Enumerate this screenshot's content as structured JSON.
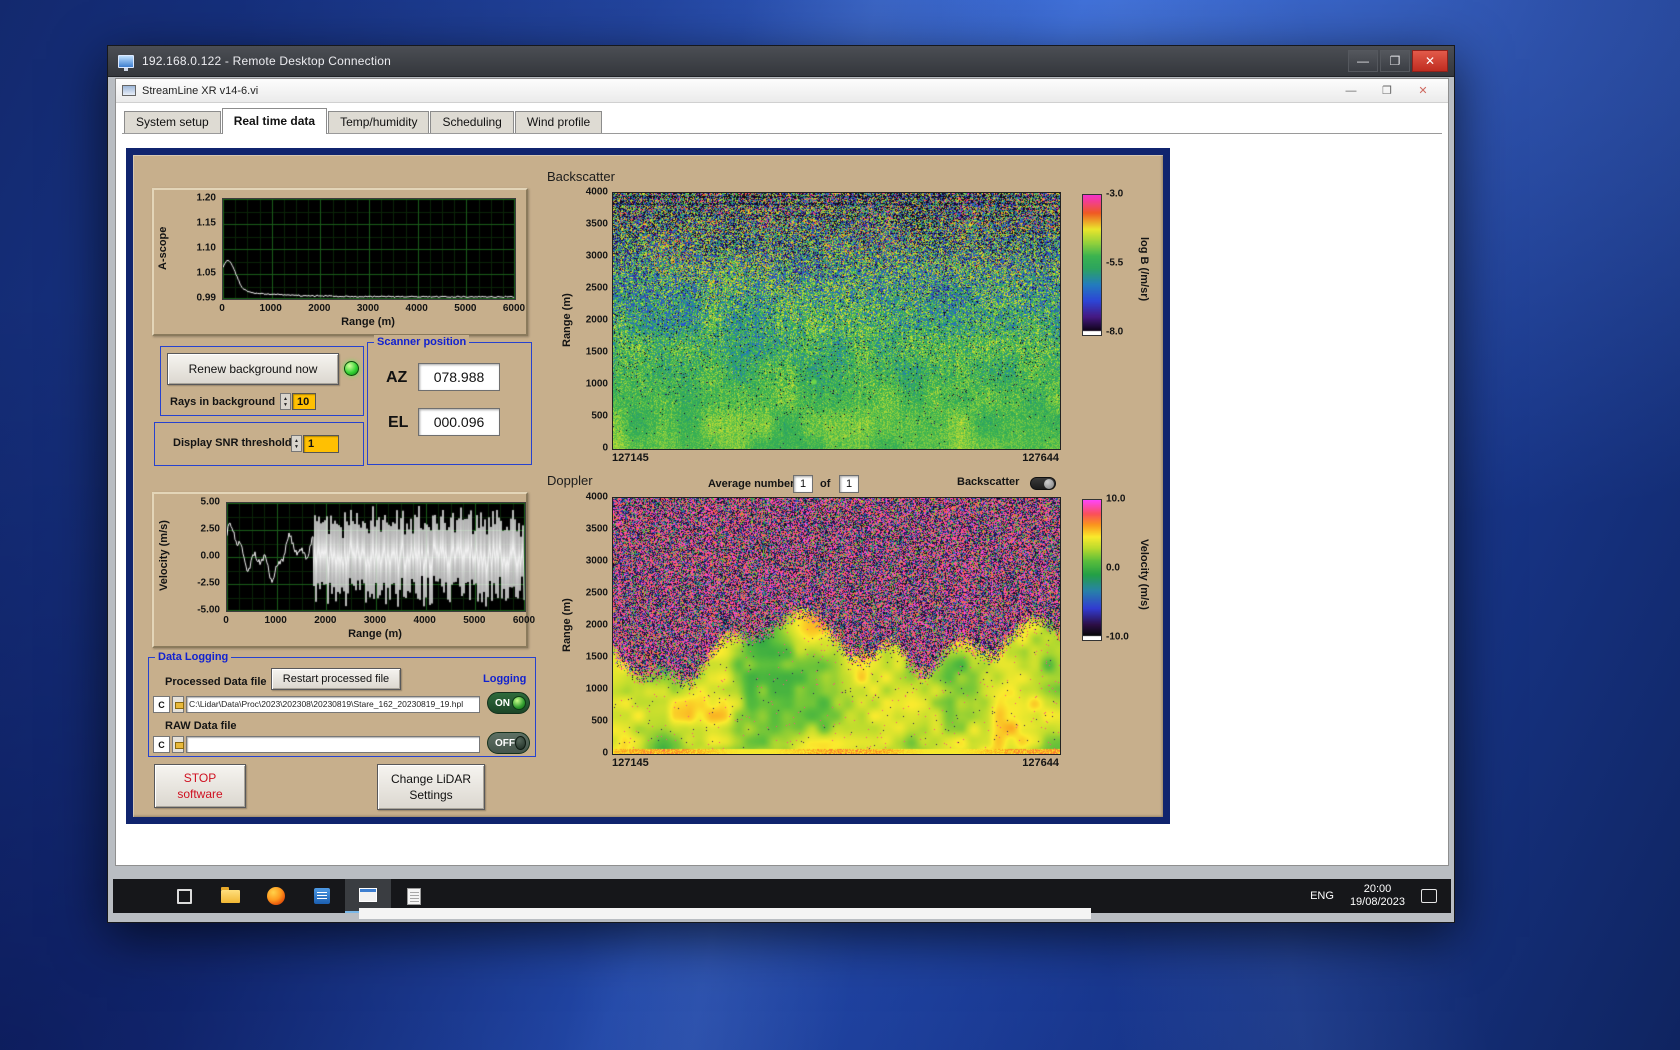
{
  "rdp": {
    "title": "192.168.0.122 - Remote Desktop Connection"
  },
  "glyphs": {
    "minimize": "—",
    "restore": "❐",
    "maximize": "▢",
    "close": "✕",
    "spin_up": "▲",
    "spin_down": "▼"
  },
  "app": {
    "title": "StreamLine XR v14-6.vi",
    "tabs": [
      {
        "label": "System setup"
      },
      {
        "label": "Real time data"
      },
      {
        "label": "Temp/humidity"
      },
      {
        "label": "Scheduling"
      },
      {
        "label": "Wind profile"
      }
    ]
  },
  "ascope": {
    "ylabel": "A-scope",
    "xlabel": "Range (m)",
    "yticks": [
      "1.20",
      "1.15",
      "1.10",
      "1.05",
      "0.99"
    ],
    "xticks": [
      "0",
      "1000",
      "2000",
      "3000",
      "4000",
      "5000",
      "6000"
    ]
  },
  "controls": {
    "renew_button": "Renew background now",
    "rays_label": "Rays in background",
    "rays_value": "10",
    "snr_label": "Display SNR threshold",
    "snr_value": "1"
  },
  "scanner": {
    "title": "Scanner position",
    "az_label": "AZ",
    "az_value": "078.988",
    "el_label": "EL",
    "el_value": "000.096"
  },
  "backscatter": {
    "title": "Backscatter",
    "ylabel": "Range (m)",
    "yticks": [
      "4000",
      "3500",
      "3000",
      "2500",
      "2000",
      "1500",
      "1000",
      "500",
      "0"
    ],
    "x_start": "127145",
    "x_end": "127644",
    "colorbar_ticks": [
      "-3.0",
      "-5.5",
      "-8.0"
    ],
    "colorbar_label": "log B (/m/sr)"
  },
  "doppler": {
    "title": "Doppler",
    "average_label": "Average number",
    "average_value": "1",
    "of_label": "of",
    "of_total": "1",
    "backscatter_toggle_label": "Backscatter",
    "ylabel": "Range (m)",
    "yticks": [
      "4000",
      "3500",
      "3000",
      "2500",
      "2000",
      "1500",
      "1000",
      "500",
      "0"
    ],
    "x_start": "127145",
    "x_end": "127644",
    "colorbar_ticks": [
      "10.0",
      "0.0",
      "-10.0"
    ],
    "colorbar_label": "Velocity (m/s)"
  },
  "velocity": {
    "ylabel": "Velocity (m/s)",
    "xlabel": "Range (m)",
    "yticks": [
      "5.00",
      "2.50",
      "0.00",
      "-2.50",
      "-5.00"
    ],
    "xticks": [
      "0",
      "1000",
      "2000",
      "3000",
      "4000",
      "5000",
      "6000"
    ]
  },
  "logging": {
    "title": "Data Logging",
    "processed_label": "Processed Data file",
    "restart_button": "Restart processed file",
    "logging_label": "Logging",
    "drive": "C",
    "processed_path": "C:\\Lidar\\Data\\Proc\\2023\\202308\\20230819\\Stare_162_20230819_19.hpl",
    "on_label": "ON",
    "raw_label": "RAW Data file",
    "raw_path": "",
    "off_label": "OFF"
  },
  "buttons": {
    "stop_line1": "STOP",
    "stop_line2": "software",
    "change_line1": "Change LiDAR",
    "change_line2": "Settings"
  },
  "taskbar": {
    "lang": "ENG",
    "time": "20:00",
    "date": "19/08/2023"
  },
  "colors": {
    "panel_tan": "#c7af8c",
    "panel_border": "#10246e",
    "group_blue": "#2742cf",
    "value_orange": "#ffc002",
    "led_green": "#35d435",
    "close_red": "#d23b2f"
  },
  "chart_data": [
    {
      "type": "line",
      "title": "A-scope",
      "xlabel": "Range (m)",
      "ylabel": "A-scope",
      "xlim": [
        0,
        6000
      ],
      "ylim": [
        0.99,
        1.2
      ],
      "x": [
        0,
        250,
        500,
        1000,
        1500,
        2000,
        2500,
        3000,
        3500,
        4000,
        4500,
        5000,
        5500,
        6000
      ],
      "values": [
        1.04,
        1.058,
        1.01,
        0.998,
        0.996,
        0.995,
        0.995,
        0.995,
        0.994,
        0.994,
        0.994,
        0.993,
        0.993,
        0.993
      ],
      "grid": true,
      "summary": "Flat baseline near 0.995 with a single peak of about 1.06 below 300 m range"
    },
    {
      "type": "heatmap",
      "title": "Backscatter",
      "ylabel": "Range (m)",
      "ylim": [
        0,
        4000
      ],
      "x_start": 127145,
      "x_end": 127644,
      "colorbar": {
        "label": "log B (/m/sr)",
        "ticks": [
          -3.0,
          -5.5,
          -8.0
        ]
      },
      "summary": "Mostly green field near -5.5 log B; smooth bright green below ~1000 m, increasingly speckled with blue/black noise toward 4000 m, faint dark horizontal streak lines near the top"
    },
    {
      "type": "line",
      "title": "Velocity",
      "xlabel": "Range (m)",
      "ylabel": "Velocity (m/s)",
      "xlim": [
        0,
        6000
      ],
      "ylim": [
        -5,
        5
      ],
      "x": [
        0,
        250,
        500,
        750,
        1000,
        1250,
        1500,
        1750
      ],
      "values": [
        2.2,
        0.3,
        -1.6,
        -0.4,
        1.0,
        0.6,
        -0.8,
        0.5
      ],
      "noise_region": [
        1750,
        6000
      ],
      "summary": "Coherent signal within ±2.5 m/s below ~1750 m, saturated ±5 m/s noise (dense vertical striping) beyond"
    },
    {
      "type": "heatmap",
      "title": "Doppler",
      "ylabel": "Range (m)",
      "ylim": [
        0,
        4000
      ],
      "x_start": 127145,
      "x_end": 127644,
      "colorbar": {
        "label": "Velocity (m/s)",
        "ticks": [
          10.0,
          0.0,
          -10.0
        ]
      },
      "summary": "Random magenta/black/green noise above a wavy ~1500-2000 m boundary; smooth green-to-yellow velocity field (~0 to +6 m/s) below, with bright yellow-orange returns near the ground"
    }
  ]
}
